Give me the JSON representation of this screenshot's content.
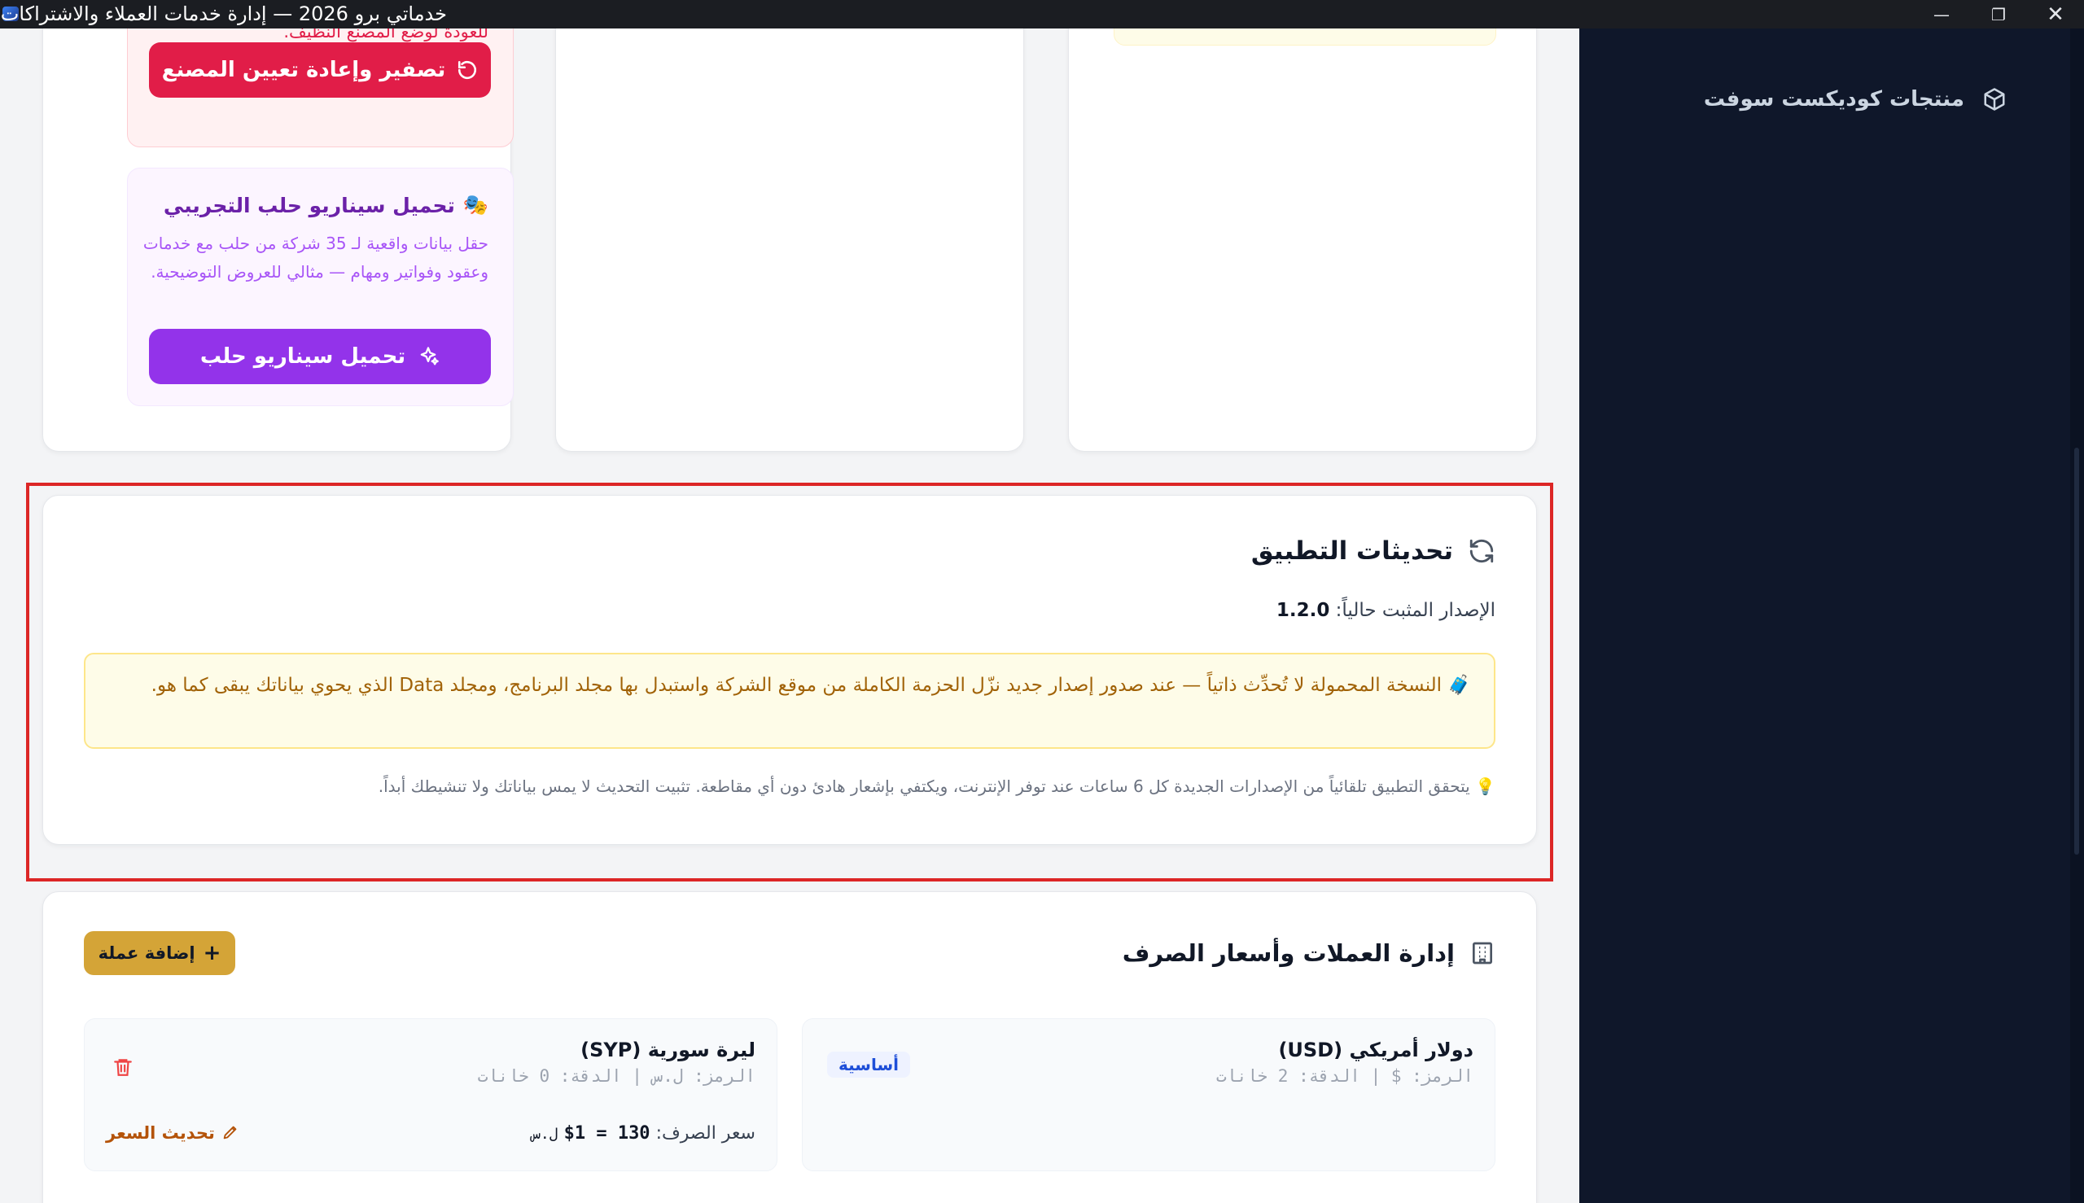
{
  "window": {
    "title": "خدماتي برو 2026 — إدارة خدمات العملاء والاشتراكات",
    "min_glyph": "—",
    "max_glyph": "❐",
    "close_glyph": "✕"
  },
  "sidebar": {
    "items": [
      {
        "label": "منتجات كوديكست سوفت",
        "icon": "box-icon"
      }
    ]
  },
  "factory_reset": {
    "note": "للعودة لوضع المصنع النظيف.",
    "button_label": "تصفير وإعادة تعيين المصنع"
  },
  "demo": {
    "title": "تحميل سيناريو حلب التجريبي",
    "emoji": "🎭",
    "description": "حقل بيانات واقعية لـ 35 شركة من حلب مع خدمات وعقود وفواتير ومهام — مثالي للعروض التوضيحية.",
    "button_label": "تحميل سيناريو حلب"
  },
  "updates": {
    "title": "تحديثات التطبيق",
    "version_label": "الإصدار المثبت حالياً:",
    "version": "1.2.0",
    "warning_emoji": "🧳",
    "warning": "النسخة المحمولة لا تُحدِّث ذاتياً — عند صدور إصدار جديد نزّل الحزمة الكاملة من موقع الشركة واستبدل بها مجلد البرنامج، ومجلد Data الذي يحوي بياناتك يبقى كما هو.",
    "hint_emoji": "💡",
    "hint": "يتحقق التطبيق تلقائياً من الإصدارات الجديدة كل 6 ساعات عند توفر الإنترنت، ويكتفي بإشعار هادئ دون أي مقاطعة. تثبيت التحديث لا يمس بياناتك ولا تنشيطك أبداً."
  },
  "currencies": {
    "title": "إدارة العملات وأسعار الصرف",
    "add_button": "إضافة عملة",
    "items": [
      {
        "name": "دولار أمريكي (USD)",
        "meta": "الرمز: $ | الدقة: 2 خانات",
        "badge": "أساسية"
      },
      {
        "name": "ليرة سورية (SYP)",
        "meta": "الرمز: ل.س | الدقة: 0 خانات",
        "rate_label": "سعر الصرف:",
        "rate_value": "$1 = 130",
        "rate_unit": "ل.س",
        "update_label": "تحديث السعر"
      }
    ]
  }
}
